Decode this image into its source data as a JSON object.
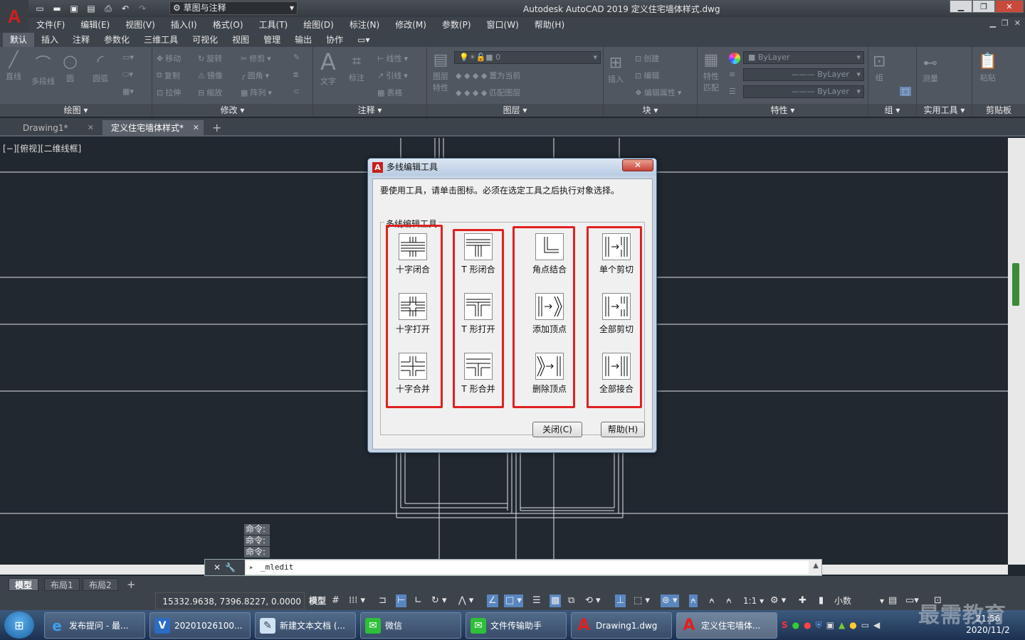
{
  "titlebar": {
    "workspace": "草图与注释",
    "title": "Autodesk AutoCAD 2019    定义住宅墙体样式.dwg"
  },
  "menu": [
    "文件(F)",
    "编辑(E)",
    "视图(V)",
    "插入(I)",
    "格式(O)",
    "工具(T)",
    "绘图(D)",
    "标注(N)",
    "修改(M)",
    "参数(P)",
    "窗口(W)",
    "帮助(H)"
  ],
  "ribbon_tabs": [
    "默认",
    "插入",
    "注释",
    "参数化",
    "三维工具",
    "可视化",
    "视图",
    "管理",
    "输出",
    "协作"
  ],
  "ribbon": {
    "draw": {
      "title": "绘图",
      "line": "直线",
      "pline": "多段线",
      "circle": "圆",
      "arc": "圆弧"
    },
    "modify": {
      "title": "修改",
      "move": "移动",
      "rotate": "旋转",
      "trim": "修剪",
      "copy": "复制",
      "mirror": "镜像",
      "fillet": "圆角",
      "stretch": "拉伸",
      "scale": "缩放",
      "array": "阵列"
    },
    "annotation": {
      "title": "注释",
      "text": "文字",
      "dim": "标注",
      "linear": "线性",
      "leader": "引线",
      "table": "表格"
    },
    "layers": {
      "title": "图层",
      "props": "图层特性",
      "current_layer": "0",
      "make_current": "置为当前",
      "match": "匹配图层"
    },
    "block": {
      "title": "块",
      "insert": "插入",
      "create": "创建",
      "edit": "编辑",
      "edit_attr": "编辑属性"
    },
    "properties": {
      "title": "特性",
      "match": "特性匹配",
      "bylayer1": "ByLayer",
      "bylayer2": "ByLayer",
      "bylayer3": "ByLayer"
    },
    "group": {
      "title": "组",
      "label": "组"
    },
    "utilities": {
      "title": "实用工具",
      "measure": "测量"
    },
    "clipboard": {
      "title": "剪贴板",
      "paste": "粘贴"
    }
  },
  "doc_tabs": [
    "Drawing1*",
    "定义住宅墙体样式*"
  ],
  "view_label": "[−][俯视][二维线框]",
  "dialog": {
    "title": "多线编辑工具",
    "close_x": "✕",
    "instruction": "要使用工具，请单击图标。必须在选定工具之后执行对象选择。",
    "group_label": "多线编辑工具",
    "tools": [
      [
        "十字闭合",
        "十字打开",
        "十字合并"
      ],
      [
        "T 形闭合",
        "T 形打开",
        "T 形合并"
      ],
      [
        "角点结合",
        "添加顶点",
        "删除顶点"
      ],
      [
        "单个剪切",
        "全部剪切",
        "全部接合"
      ]
    ],
    "close_button": "关闭(C)",
    "help_button": "帮助(H)"
  },
  "command": {
    "history": [
      "命令:",
      "命令:",
      "命令:"
    ],
    "input": "_mledit"
  },
  "layout_tabs": [
    "模型",
    "布局1",
    "布局2"
  ],
  "status": {
    "coords": "15332.9638, 7396.8227, 0.0000",
    "model": "模型",
    "scale": "1:1",
    "units": "小数"
  },
  "taskbar": {
    "items": [
      "发布提问 - 最...",
      "20201026100...",
      "新建文本文档 (...",
      "微信",
      "文件传输助手",
      "Drawing1.dwg",
      "定义住宅墙体..."
    ],
    "time": "21:56",
    "date": "2020/11/2"
  },
  "watermark": "最需教育",
  "colors": {
    "highlight": "#e02020",
    "canvas": "#212830",
    "ribbon": "#505761"
  }
}
